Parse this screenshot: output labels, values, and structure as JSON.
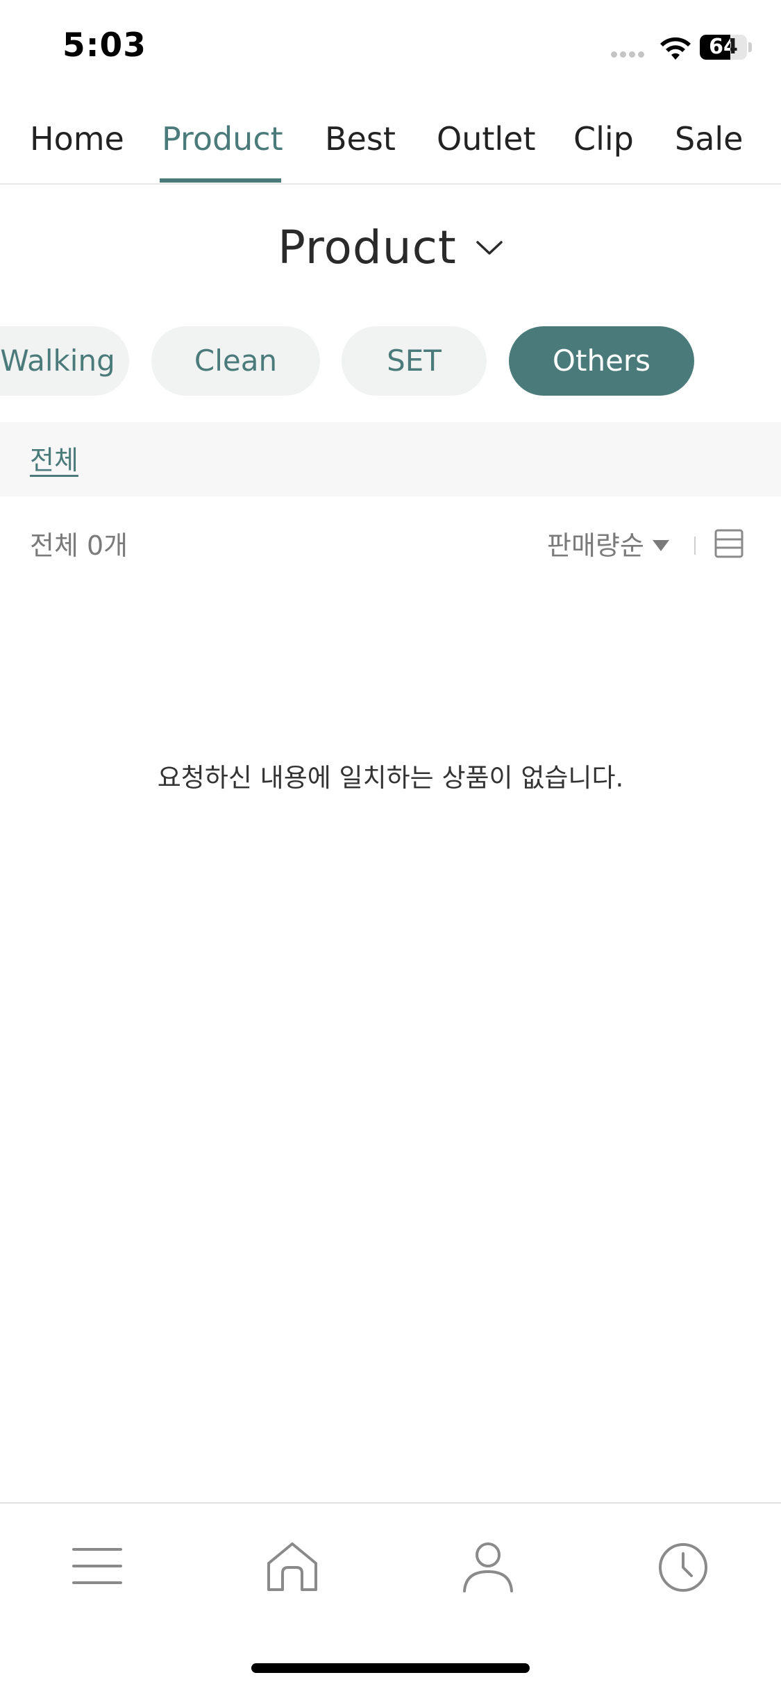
{
  "status_bar": {
    "time": "5:03",
    "battery_level": "64",
    "battery_fraction": 0.64
  },
  "top_nav": {
    "tabs": [
      {
        "label": "Home",
        "active": false
      },
      {
        "label": "Product",
        "active": true
      },
      {
        "label": "Best",
        "active": false
      },
      {
        "label": "Outlet",
        "active": false
      },
      {
        "label": "Clip",
        "active": false
      },
      {
        "label": "Sale",
        "active": false
      }
    ]
  },
  "page": {
    "title": "Product",
    "title_icon": "chevron-down-icon"
  },
  "categories": [
    {
      "label": "Walking",
      "active": false
    },
    {
      "label": "Clean",
      "active": false
    },
    {
      "label": "SET",
      "active": false
    },
    {
      "label": "Others",
      "active": true
    }
  ],
  "subcategory": {
    "label": "전체"
  },
  "list_header": {
    "count_text": "전체 0개",
    "sort_label": "판매량순",
    "sort_icon": "caret-down-icon",
    "view_icon": "list-view-icon"
  },
  "empty_message": "요청하신 내용에 일치하는 상품이 없습니다.",
  "bottom_bar": {
    "items": [
      {
        "icon": "menu-icon"
      },
      {
        "icon": "home-icon"
      },
      {
        "icon": "user-icon"
      },
      {
        "icon": "clock-icon"
      }
    ]
  },
  "colors": {
    "accent": "#4a7b7a",
    "chip_bg": "#f1f2f2",
    "subcat_bg": "#f7f7f7",
    "text_primary": "#222222",
    "text_muted": "#7a7a7a",
    "icon_gray": "#8a8a8a"
  }
}
